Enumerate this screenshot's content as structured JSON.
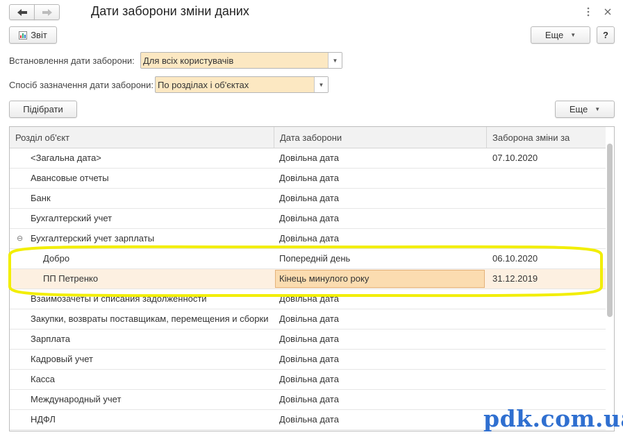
{
  "window": {
    "title": "Дати заборони зміни даних",
    "back_icon": "arrow-left-icon",
    "forward_icon": "arrow-right-icon",
    "menu_icon": "more-vertical-icon",
    "close_icon": "close-icon"
  },
  "toolbar": {
    "report_label": "Звіт",
    "more_label": "Еще",
    "help_label": "?"
  },
  "filters": {
    "set_date_label": "Встановлення дати заборони:",
    "set_date_value": "Для всіх користувачів",
    "method_label": "Спосіб зазначення дати заборони:",
    "method_value": "По розділах і об'єктах"
  },
  "grid_toolbar": {
    "pick_label": "Підібрати",
    "more_label": "Еще"
  },
  "table": {
    "columns": [
      "Розділ об'єкт",
      "Дата заборони",
      "Заборона зміни за"
    ],
    "rows": [
      {
        "section": "<Загальна дата>",
        "date_type": "Довільна дата",
        "date": "07.10.2020"
      },
      {
        "section": "Авансовые отчеты",
        "date_type": "Довільна дата",
        "date": ""
      },
      {
        "section": "Банк",
        "date_type": "Довільна дата",
        "date": ""
      },
      {
        "section": "Бухгалтерский учет",
        "date_type": "Довільна дата",
        "date": ""
      },
      {
        "section": "Бухгалтерский учет зарплаты",
        "date_type": "Довільна дата",
        "date": "",
        "expander": "⊖"
      },
      {
        "section": "Добро",
        "date_type": "Попередній день",
        "date": "06.10.2020"
      },
      {
        "section": "ПП Петренко",
        "date_type": "Кінець минулого року",
        "date": "31.12.2019"
      },
      {
        "section": "Взаимозачеты и списания задолженности",
        "date_type": "Довільна дата",
        "date": ""
      },
      {
        "section": "Закупки, возвраты поставщикам, перемещения и сборки",
        "date_type": "Довільна дата",
        "date": ""
      },
      {
        "section": "Зарплата",
        "date_type": "Довільна дата",
        "date": ""
      },
      {
        "section": "Кадровый учет",
        "date_type": "Довільна дата",
        "date": ""
      },
      {
        "section": "Касса",
        "date_type": "Довільна дата",
        "date": ""
      },
      {
        "section": "Международный учет",
        "date_type": "Довільна дата",
        "date": ""
      },
      {
        "section": "НДФЛ",
        "date_type": "Довільна дата",
        "date": ""
      }
    ]
  },
  "annotation": {
    "color": "#f2ee00"
  },
  "watermark": {
    "text": "pdk.com.ua",
    "color": "#2f6fd0"
  },
  "colors": {
    "field_bg": "#fce8c2",
    "selected_row_bg": "#fdf0e1",
    "edit_cell_bg": "#fbdcb0"
  }
}
